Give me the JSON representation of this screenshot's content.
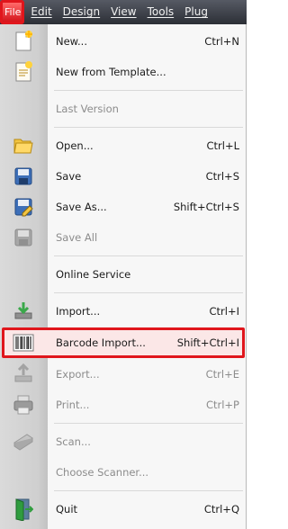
{
  "menubar": {
    "items": [
      {
        "label": "File"
      },
      {
        "label": "Edit"
      },
      {
        "label": "Design"
      },
      {
        "label": "View"
      },
      {
        "label": "Tools"
      },
      {
        "label": "Plug"
      }
    ]
  },
  "menu": {
    "items": [
      {
        "label": "New...",
        "shortcut": "Ctrl+N",
        "icon": "new-document-icon",
        "enabled": true
      },
      {
        "label": "New from Template...",
        "shortcut": "",
        "icon": "new-template-icon",
        "enabled": true
      },
      {
        "label": "Last Version",
        "shortcut": "",
        "icon": "",
        "enabled": false
      },
      {
        "label": "Open...",
        "shortcut": "Ctrl+L",
        "icon": "open-folder-icon",
        "enabled": true
      },
      {
        "label": "Save",
        "shortcut": "Ctrl+S",
        "icon": "save-disk-icon",
        "enabled": true
      },
      {
        "label": "Save As...",
        "shortcut": "Shift+Ctrl+S",
        "icon": "save-as-icon",
        "enabled": true
      },
      {
        "label": "Save All",
        "shortcut": "",
        "icon": "save-all-icon",
        "enabled": false
      },
      {
        "label": "Online Service",
        "shortcut": "",
        "icon": "",
        "enabled": true
      },
      {
        "label": "Import...",
        "shortcut": "Ctrl+I",
        "icon": "import-icon",
        "enabled": true
      },
      {
        "label": "Barcode Import...",
        "shortcut": "Shift+Ctrl+I",
        "icon": "barcode-icon",
        "enabled": true,
        "highlighted": true
      },
      {
        "label": "Export...",
        "shortcut": "Ctrl+E",
        "icon": "export-icon",
        "enabled": false
      },
      {
        "label": "Print...",
        "shortcut": "Ctrl+P",
        "icon": "printer-icon",
        "enabled": false
      },
      {
        "label": "Scan...",
        "shortcut": "",
        "icon": "scanner-icon",
        "enabled": false
      },
      {
        "label": "Choose Scanner...",
        "shortcut": "",
        "icon": "",
        "enabled": false
      },
      {
        "label": "Quit",
        "shortcut": "Ctrl+Q",
        "icon": "exit-door-icon",
        "enabled": true
      }
    ]
  },
  "colors": {
    "highlight_border": "#e0161c",
    "file_button": "#d4151b",
    "menubar": "#3a3d45",
    "gutter": "#d0d0d0"
  }
}
